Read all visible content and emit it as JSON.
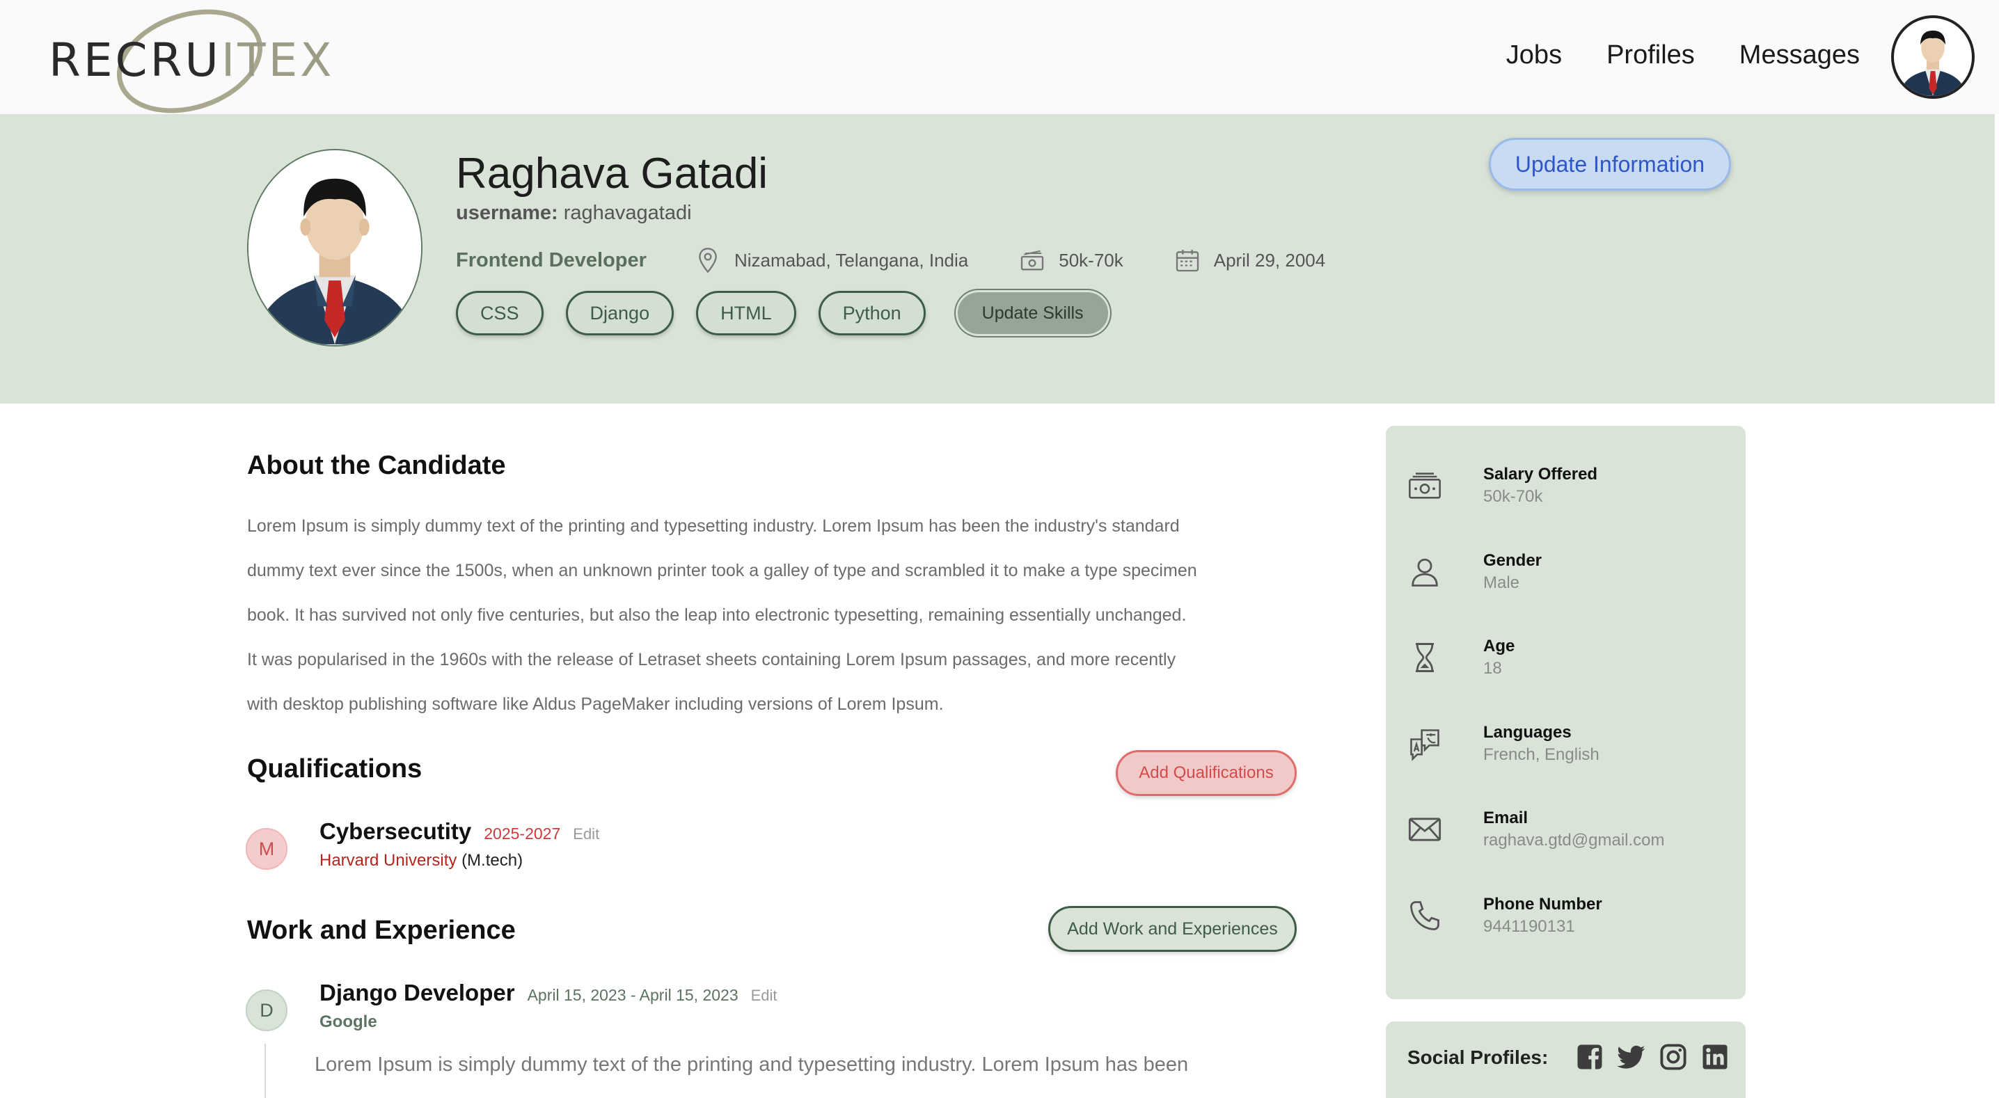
{
  "brand": {
    "name_dark_1": "RECRU",
    "name_light": "I",
    "name_dark_2": "TEX"
  },
  "nav": {
    "links": [
      "Jobs",
      "Profiles",
      "Messages"
    ]
  },
  "profile": {
    "name": "Raghava Gatadi",
    "username_label": "username:",
    "username": "raghavagatadi",
    "role": "Frontend Developer",
    "location": "Nizamabad, Telangana, India",
    "salary": "50k-70k",
    "dob": "April 29, 2004",
    "skills": [
      "CSS",
      "Django",
      "HTML",
      "Python"
    ],
    "update_skills_label": "Update Skills",
    "update_info_label": "Update Information"
  },
  "about": {
    "heading": "About the Candidate",
    "lines": [
      "Lorem Ipsum is simply dummy text of the printing and typesetting industry. Lorem Ipsum has been the industry's standard",
      "dummy text ever since the 1500s, when an unknown printer took a galley of type and scrambled it to make a type specimen",
      "book. It has survived not only five centuries, but also the leap into electronic typesetting, remaining essentially unchanged.",
      "It was popularised in the 1960s with the release of Letraset sheets containing Lorem Ipsum passages, and more recently",
      "with desktop publishing software like Aldus PageMaker including versions of Lorem Ipsum."
    ]
  },
  "qualifications": {
    "heading": "Qualifications",
    "add_label": "Add Qualifications",
    "items": [
      {
        "badge": "M",
        "title": "Cybersecutity",
        "range": "2025-2027",
        "edit": "Edit",
        "institution": "Harvard University",
        "degree": "(M.tech)"
      }
    ]
  },
  "experience": {
    "heading": "Work and Experience",
    "add_label": "Add Work and Experiences",
    "items": [
      {
        "badge": "D",
        "title": "Django Developer",
        "range": "April 15, 2023 - April 15, 2023",
        "edit": "Edit",
        "company": "Google",
        "description": "Lorem Ipsum is simply dummy text of the printing and typesetting industry. Lorem Ipsum has been"
      }
    ]
  },
  "sidebar": {
    "items": [
      {
        "icon": "cash-icon",
        "label": "Salary Offered",
        "value": "50k-70k"
      },
      {
        "icon": "person-icon",
        "label": "Gender",
        "value": "Male"
      },
      {
        "icon": "hourglass-icon",
        "label": "Age",
        "value": "18"
      },
      {
        "icon": "translate-icon",
        "label": "Languages",
        "value": "French, English"
      },
      {
        "icon": "envelope-icon",
        "label": "Email",
        "value": "raghava.gtd@gmail.com"
      },
      {
        "icon": "phone-icon",
        "label": "Phone Number",
        "value": "9441190131"
      }
    ],
    "social_label": "Social Profiles:",
    "social_icons": [
      "facebook-icon",
      "twitter-icon",
      "instagram-icon",
      "linkedin-icon"
    ]
  },
  "colors": {
    "band": "#d9e3d8",
    "accent_green": "#3f5c47",
    "accent_red": "#d24a4a",
    "accent_blue": "#2f56c9"
  }
}
